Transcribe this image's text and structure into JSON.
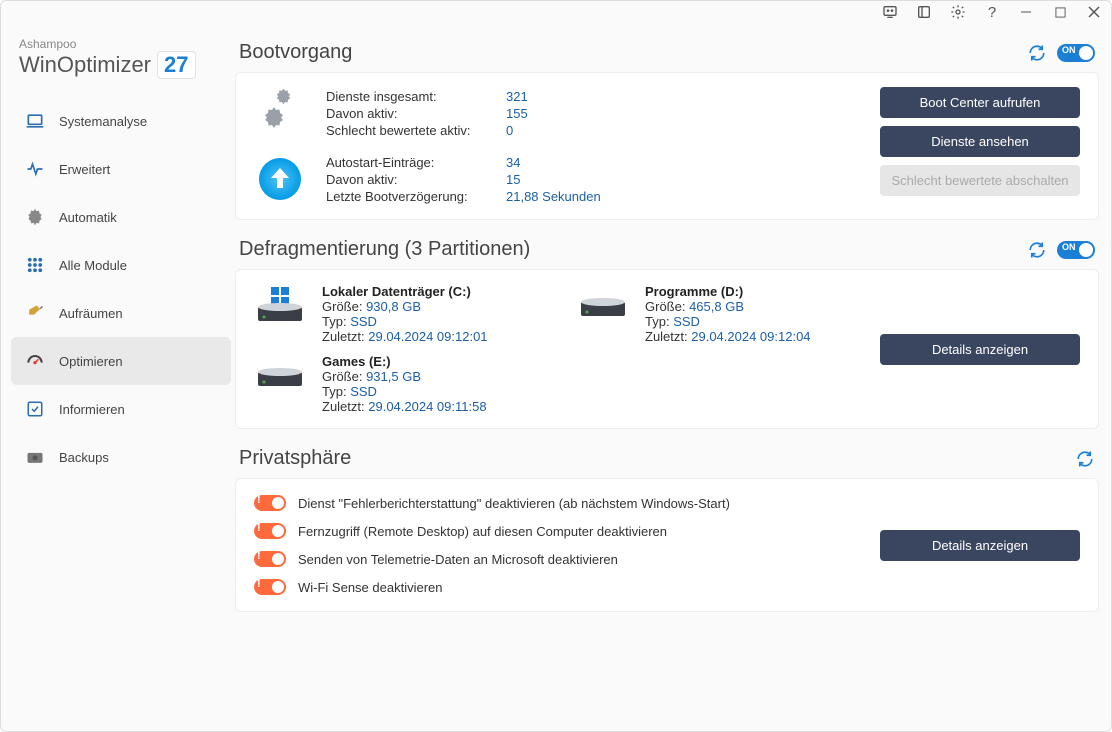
{
  "brand": {
    "company": "Ashampoo",
    "product": "WinOptimizer",
    "version": "27"
  },
  "toggle_on_label": "ON",
  "sidebar": {
    "items": [
      {
        "id": "system-analyse",
        "label": "Systemanalyse"
      },
      {
        "id": "erweitert",
        "label": "Erweitert"
      },
      {
        "id": "automatik",
        "label": "Automatik"
      },
      {
        "id": "alle-module",
        "label": "Alle Module"
      },
      {
        "id": "aufraeumen",
        "label": "Aufräumen"
      },
      {
        "id": "optimieren",
        "label": "Optimieren"
      },
      {
        "id": "informieren",
        "label": "Informieren"
      },
      {
        "id": "backups",
        "label": "Backups"
      }
    ]
  },
  "boot": {
    "title": "Bootvorgang",
    "services": {
      "total_label": "Dienste insgesamt:",
      "total": "321",
      "active_label": "Davon aktiv:",
      "active": "155",
      "bad_label": "Schlecht bewertete aktiv:",
      "bad": "0"
    },
    "autostart": {
      "entries_label": "Autostart-Einträge:",
      "entries": "34",
      "active_label": "Davon aktiv:",
      "active": "15",
      "delay_label": "Letzte Bootverzögerung:",
      "delay": "21,88 Sekunden"
    },
    "buttons": {
      "boot_center": "Boot Center aufrufen",
      "services": "Dienste ansehen",
      "disable_bad": "Schlecht bewertete abschalten"
    }
  },
  "defrag": {
    "title": "Defragmentierung (3 Partitionen)",
    "size_label": "Größe: ",
    "type_label": "Typ: ",
    "last_label": "Zuletzt: ",
    "details_button": "Details anzeigen",
    "drives": [
      {
        "name": "Lokaler Datenträger (C:)",
        "size": "930,8 GB",
        "type": "SSD",
        "last": "29.04.2024 09:12:01",
        "os": true
      },
      {
        "name": "Programme (D:)",
        "size": "465,8 GB",
        "type": "SSD",
        "last": "29.04.2024 09:12:04",
        "os": false
      },
      {
        "name": "Games (E:)",
        "size": "931,5 GB",
        "type": "SSD",
        "last": "29.04.2024 09:11:58",
        "os": false
      }
    ]
  },
  "privacy": {
    "title": "Privatsphäre",
    "details_button": "Details anzeigen",
    "items": [
      "Dienst \"Fehlerberichterstattung\" deaktivieren (ab nächstem Windows-Start)",
      "Fernzugriff (Remote Desktop) auf diesen Computer deaktivieren",
      "Senden von Telemetrie-Daten an Microsoft deaktivieren",
      "Wi-Fi Sense deaktivieren"
    ]
  }
}
